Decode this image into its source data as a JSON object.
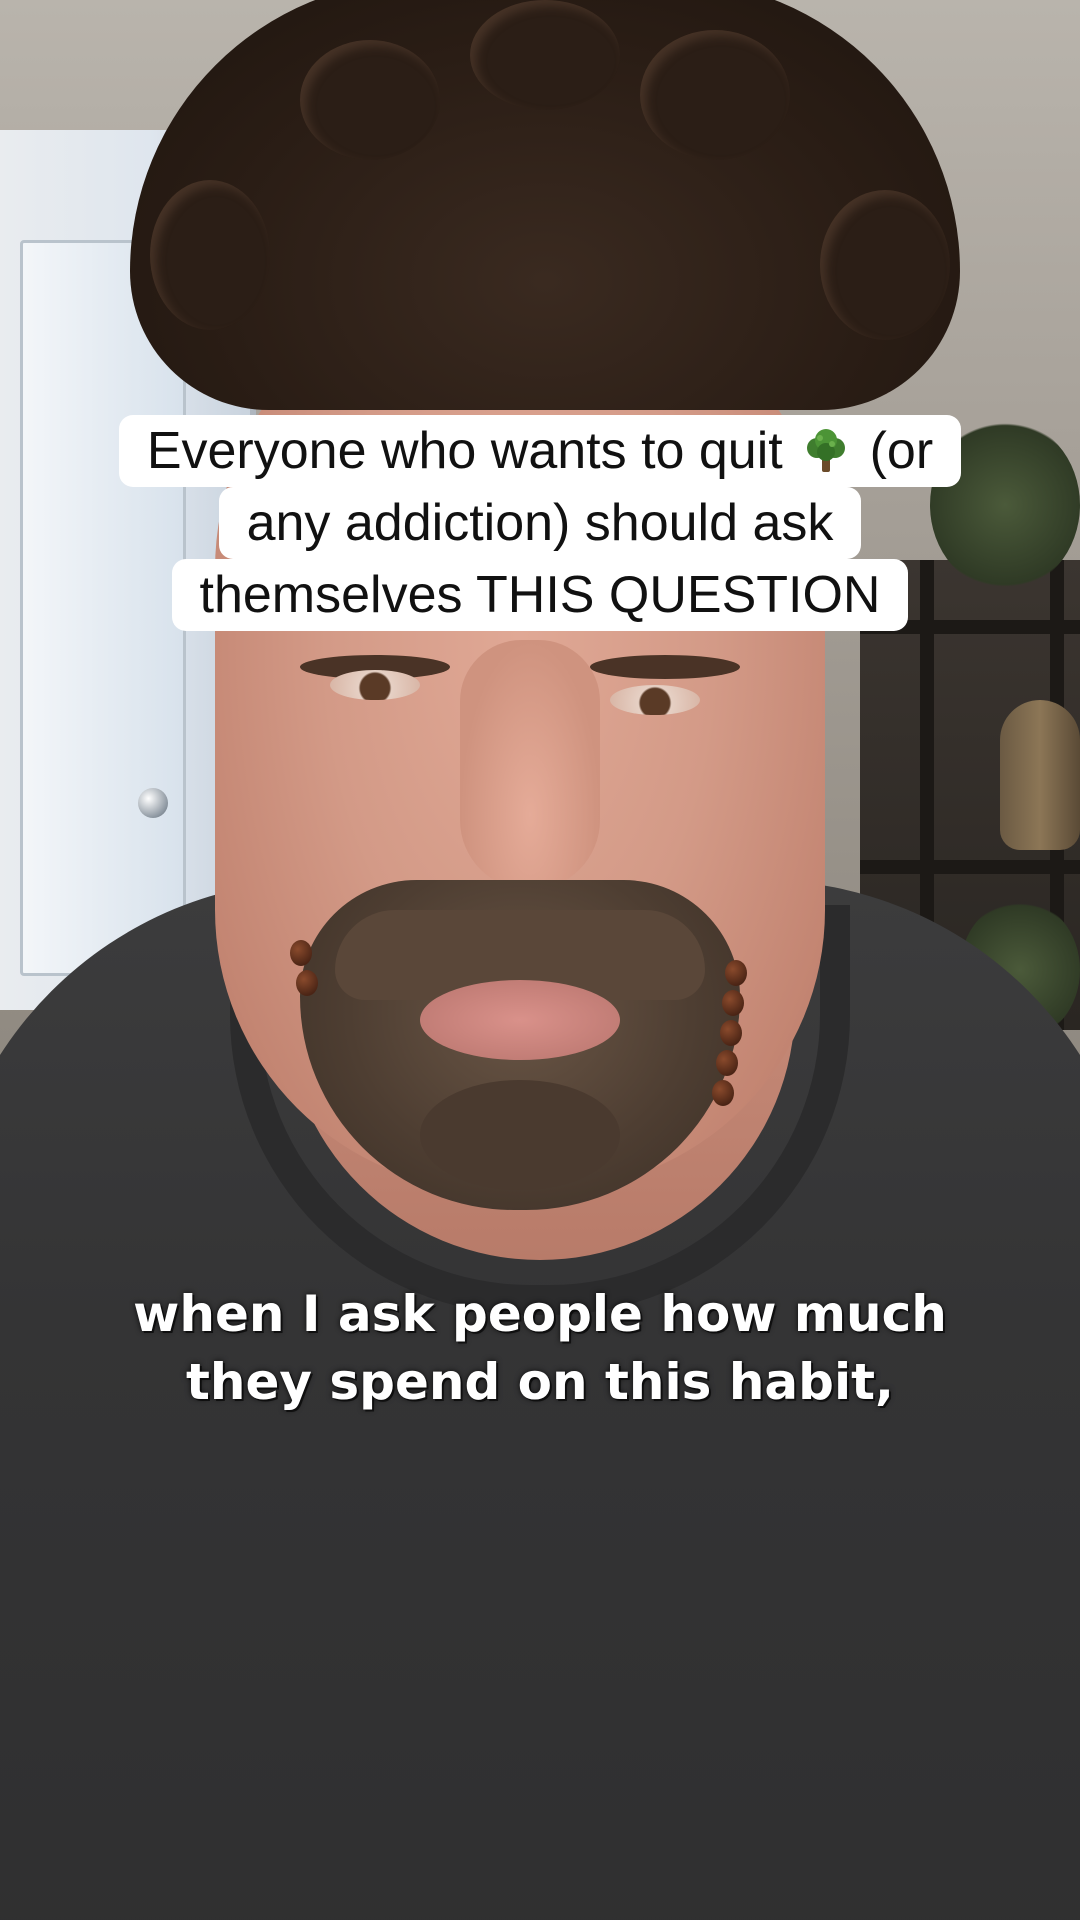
{
  "overlay_title": {
    "line1_before_emoji": "Everyone who wants to quit",
    "emoji_icon": "broccoli-tree-icon",
    "line1_after_emoji": "(or",
    "line2": "any addiction) should ask",
    "line3": "themselves THIS QUESTION"
  },
  "caption": {
    "line1": "when I ask people how much",
    "line2": "they spend on this habit,"
  }
}
